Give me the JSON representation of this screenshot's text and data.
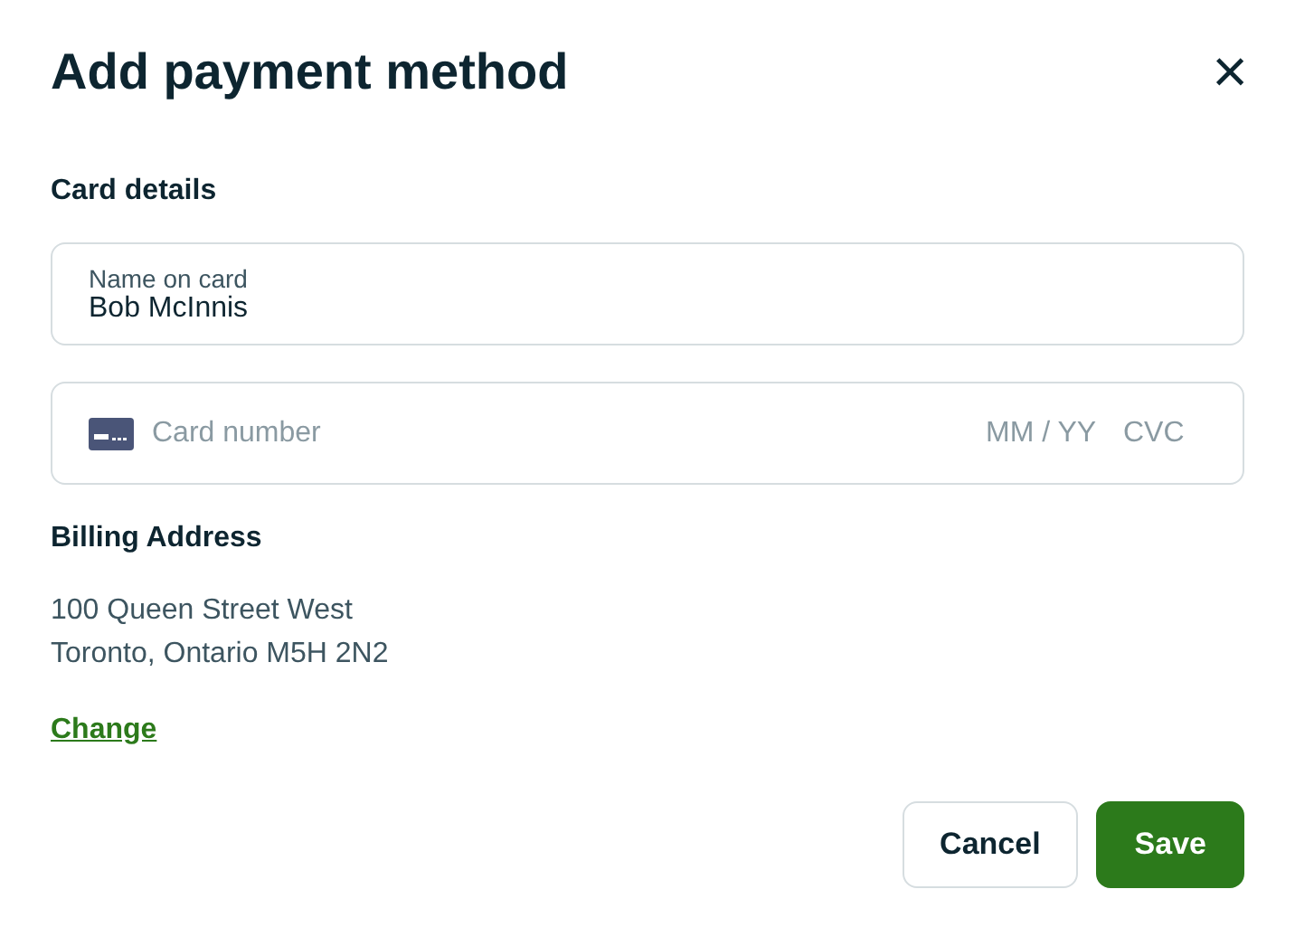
{
  "dialog": {
    "title": "Add payment method",
    "close_icon": "×"
  },
  "card_details": {
    "heading": "Card details",
    "name_field": {
      "label": "Name on card",
      "value": "Bob McInnis"
    },
    "card_field": {
      "number_placeholder": "Card number",
      "expiry_placeholder": "MM / YY",
      "cvc_placeholder": "CVC"
    }
  },
  "billing": {
    "heading": "Billing Address",
    "lines": [
      "100 Queen Street West",
      "Toronto, Ontario M5H 2N2"
    ],
    "change_link": "Change"
  },
  "buttons": [
    {
      "label": "Cancel",
      "kind": "secondary"
    },
    {
      "label": "Save",
      "kind": "primary"
    }
  ]
}
